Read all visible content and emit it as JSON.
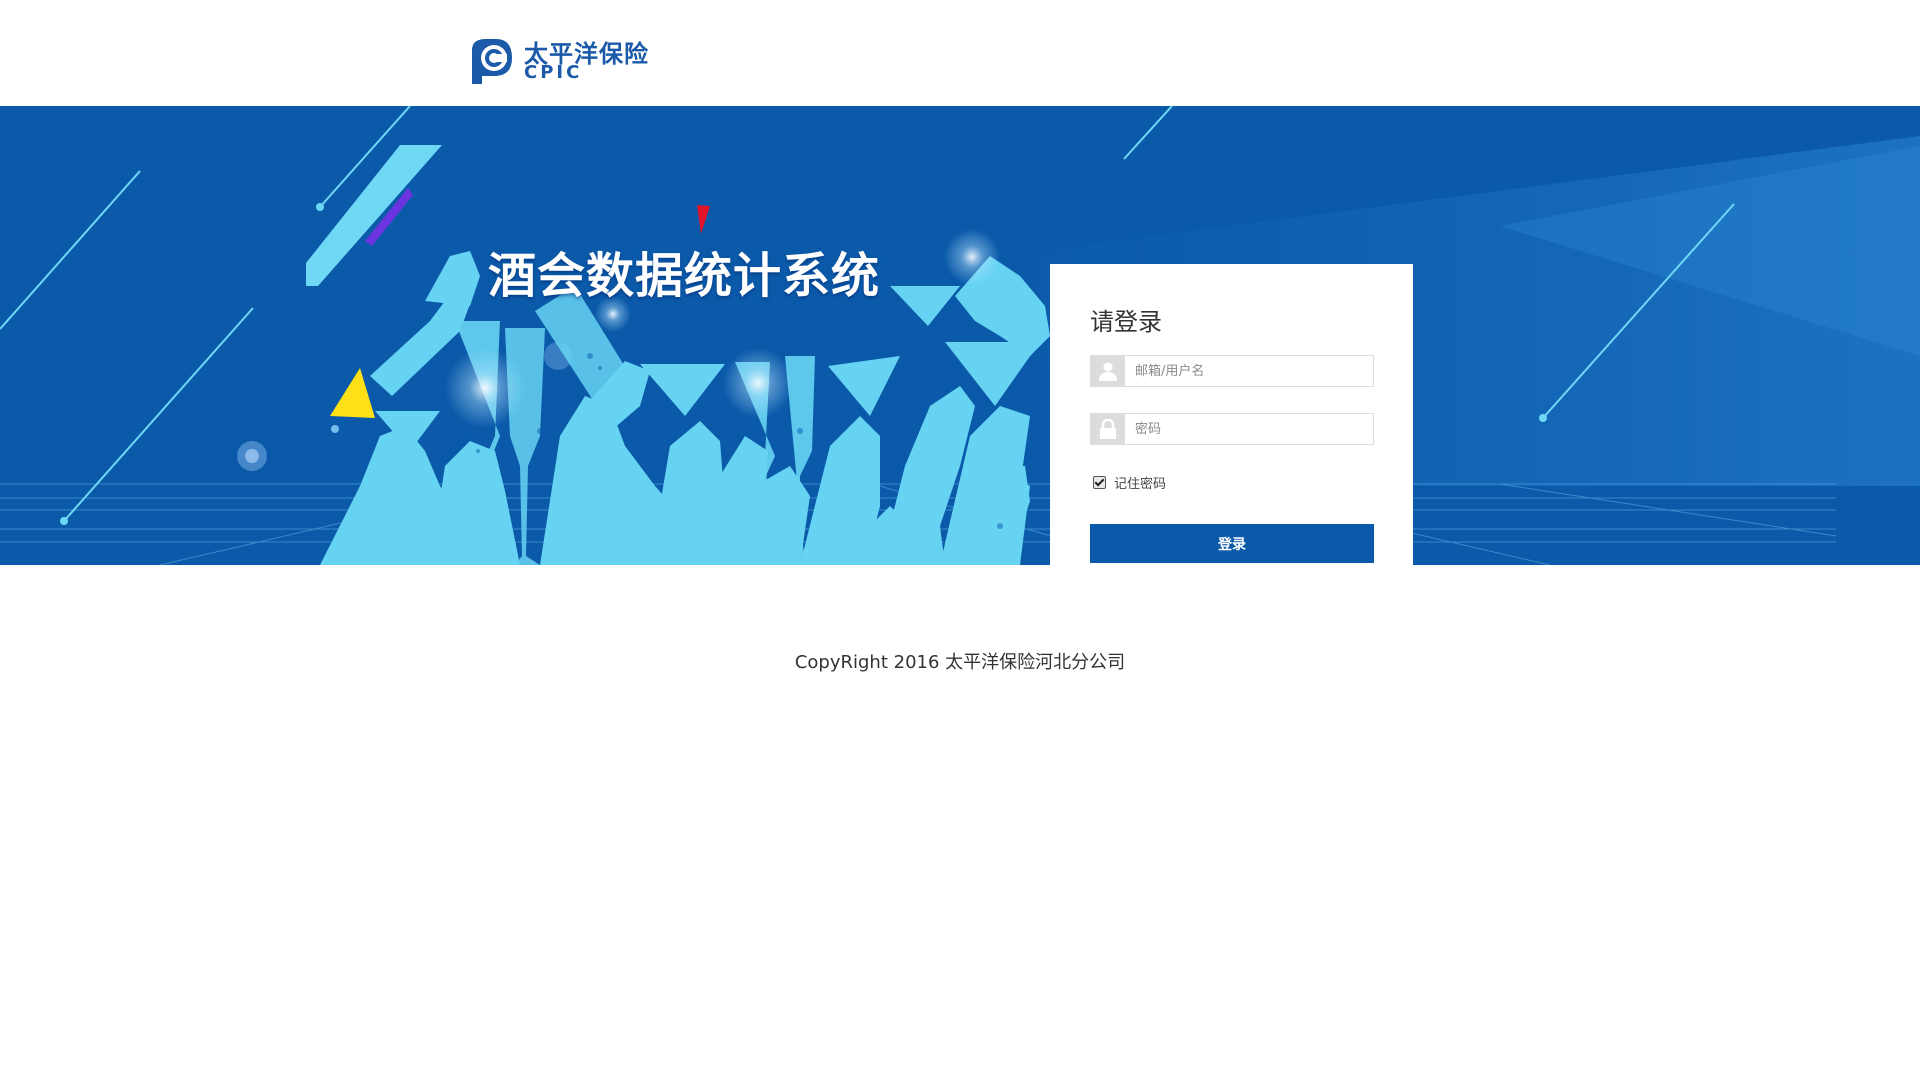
{
  "header": {
    "logo": {
      "name_cn": "太平洋保险",
      "name_en": "CPIC",
      "color": "#1a5aa8"
    }
  },
  "banner": {
    "title": "酒会数据统计系统",
    "background_color": "#0b5aaa",
    "accent_color": "#6fd8f5"
  },
  "login": {
    "heading": "请登录",
    "username": {
      "placeholder": "邮箱/用户名",
      "value": "",
      "icon": "user-icon"
    },
    "password": {
      "placeholder": "密码",
      "value": "",
      "icon": "lock-icon"
    },
    "remember_label": "记住密码",
    "remember_checked": true,
    "submit_label": "登录",
    "button_color": "#0b5aaa"
  },
  "footer": {
    "copyright": "CopyRight 2016 太平洋保险河北分公司"
  }
}
